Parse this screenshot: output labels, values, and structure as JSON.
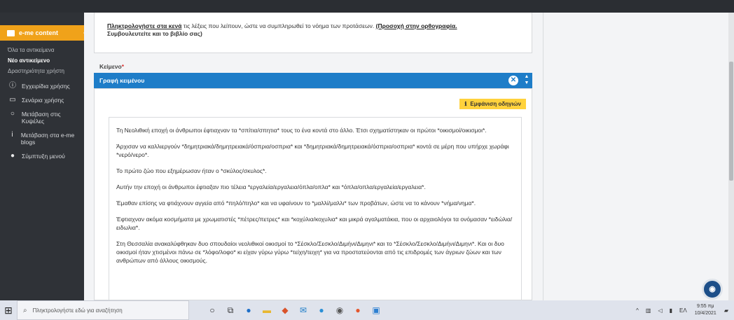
{
  "sidebar": {
    "active": "e-me content",
    "subitems": [
      {
        "label": "Όλα τα αντικείμενα",
        "current": false
      },
      {
        "label": "Νέο αντικείμενο",
        "current": true
      },
      {
        "label": "Δραστηριότητα χρήστη",
        "current": false
      }
    ],
    "items": [
      {
        "icon": "help-circle-icon",
        "glyph": "ⓘ",
        "label": "Εγχειρίδια χρήσης"
      },
      {
        "icon": "monitor-icon",
        "glyph": "▭",
        "label": "Σενάρια χρήσης"
      },
      {
        "icon": "circle-icon",
        "glyph": "○",
        "label": "Μετάβαση στις Κυψέλες"
      },
      {
        "icon": "info-icon",
        "glyph": "ⅰ",
        "label": "Μετάβαση στα e-me blogs"
      },
      {
        "icon": "dot-icon",
        "glyph": "●",
        "label": "Σύμπτυξη μενού"
      }
    ]
  },
  "instructions": {
    "link1": "Πληκτρολογήστε στα κενά",
    "middle": " τις λέξεις που λείπουν, ώστε να συμπληρωθεί το νόημα των προτάσεων.",
    "link2": "(Προσοχή στην ορθογραφία.",
    "line2": "Συμβουλευτείτε και το βιβλίο σας)"
  },
  "field": {
    "label": "Κείμενο",
    "required": "*"
  },
  "editor": {
    "bar_title": "Γραφή κειμένου",
    "guide_button": "Εμφάνιση οδηγιών",
    "paragraphs": [
      "Τη Νεολιθική εποχή οι άνθρωποι έφτιαχναν τα *σπίτια/σπητια* τους το ένα κοντά στο άλλο. Έτσι σχηματίστηκαν οι πρώτοι *οικισμοί/οικισμοι*.",
      "Άρχισαν να καλλιεργούν *δημητριακά/δημητρειακά/όσπρια/οσπρια* και *δημητριακά/δημητρειακά/όσπρια/οσπρια* κοντά σε μέρη που υπήρχε χωράφι *νερό/νερο*.",
      "Το πρώτο ζώο που εξημέρωσαν ήταν ο *σκύλος/σκυλος*.",
      "Αυτήν την εποχή οι άνθρωποι έφτιαξαν πιο τέλεια *εργαλεία/εργαλεια/όπλα/οπλα* και *όπλα/οπλα/εργαλεία/εργαλεια*.",
      "Έμαθαν επίσης να φτιάχνουν αγγεία από *πηλό/πηλο* και να υφαίνουν το *μαλλί/μαλλι* των προβάτων, ώστε να το κάνουν *νήμα/νημα*.",
      "Έφτιαχναν ακόμα κοσμήματα με χρωματιστές *πέτρες/πετρες* και *κοχύλια/κοχυλια* και μικρά αγαλματάκια, που οι αρχαιολόγοι τα ονόμασαν *ειδώλια/ειδωλια*.",
      "Στη Θεσσαλία ανακαλύφθηκαν δυο σπουδαίοι νεολιθικοί οικισμοί το *Σέσκλο/Σεσκλο/Διμήνι/Διμηνι* και το *Σέσκλο/Σεσκλο/Διμήνι/Διμηνι*. Και οι δυο οικισμοί ήταν χτισμένοι πάνω σε *λόφο/λοφο* κι είχαν γύρω γύρω *τείχη/τειχη* για να προστατεύονται από τις επιδρομές των άγριων ζώων και των ανθρώπων από άλλους οικισμούς."
    ]
  },
  "taskbar": {
    "search_placeholder": "Πληκτρολογήστε εδώ για αναζήτηση",
    "apps": [
      {
        "icon": "circle-icon",
        "glyph": "○",
        "color": "#222222"
      },
      {
        "icon": "task-view-icon",
        "glyph": "⧉",
        "color": "#333333"
      },
      {
        "icon": "edge-icon",
        "glyph": "●",
        "color": "#1e6fc8"
      },
      {
        "icon": "folder-icon",
        "glyph": "▬",
        "color": "#e8b730"
      },
      {
        "icon": "app-icon",
        "glyph": "◆",
        "color": "#d9532a"
      },
      {
        "icon": "mail-icon",
        "glyph": "✉",
        "color": "#1e7dc8"
      },
      {
        "icon": "chrome-icon",
        "glyph": "●",
        "color": "#2a8fd6"
      },
      {
        "icon": "camera-icon",
        "glyph": "◉",
        "color": "#555555"
      },
      {
        "icon": "firefox-icon",
        "glyph": "●",
        "color": "#e4572e"
      },
      {
        "icon": "photos-icon",
        "glyph": "▣",
        "color": "#2c7fd1"
      }
    ],
    "lang": "ΕΛ",
    "time": "9:55 πμ",
    "date": "10/4/2021"
  }
}
